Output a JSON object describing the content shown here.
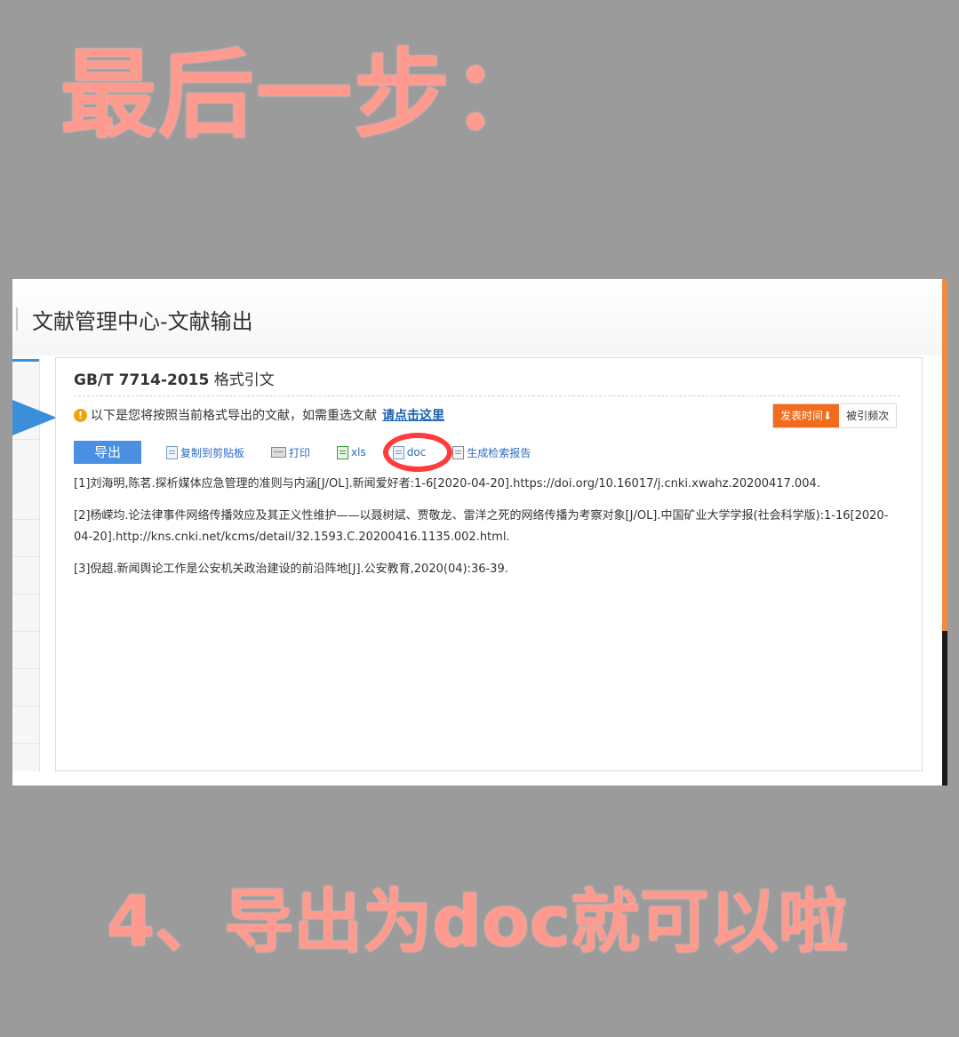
{
  "overlay": {
    "top_heading": "最后一步：",
    "bottom_heading": "4、导出为doc就可以啦"
  },
  "page": {
    "title": "文献管理中心-文献输出"
  },
  "panel": {
    "title_bold": "GB/T 7714-2015",
    "title_tail": " 格式引文",
    "notice_icon": "!",
    "notice_text": "以下是您将按照当前格式导出的文献，如需重选文献",
    "notice_link": "请点击这里",
    "sort": {
      "active_label": "发表时间",
      "active_arrow": "⬇",
      "other_label": "被引频次"
    },
    "toolbar": {
      "export_label": "导出",
      "copy_label": "复制到剪贴板",
      "print_label": "打印",
      "xls_label": "xls",
      "doc_label": "doc",
      "report_label": "生成检索报告"
    },
    "references": [
      "[1]刘海明,陈茗.探析媒体应急管理的准则与内涵[J/OL].新闻爱好者:1-6[2020-04-20].https://doi.org/10.16017/j.cnki.xwahz.20200417.004.",
      "[2]杨嵘均.论法律事件网络传播效应及其正义性维护——以聂树斌、贾敬龙、雷洋之死的网络传播为考察对象[J/OL].中国矿业大学学报(社会科学版):1-16[2020-04-20].http://kns.cnki.net/kcms/detail/32.1593.C.20200416.1135.002.html.",
      "[3]倪超.新闻舆论工作是公安机关政治建设的前沿阵地[J].公安教育,2020(04):36-39."
    ]
  },
  "colors": {
    "overlay_text": "#ff9a8f",
    "accent_blue": "#4a90e2",
    "sort_active": "#f26c1d",
    "highlight_circle": "#ff3b3b"
  }
}
